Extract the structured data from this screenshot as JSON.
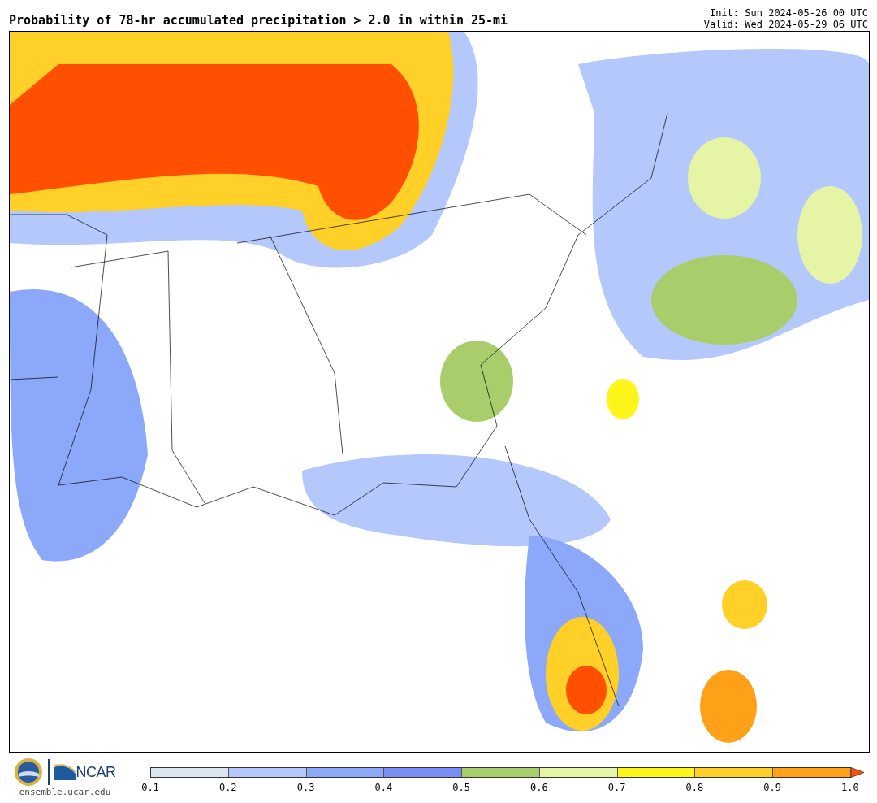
{
  "title": "Probability of 78-hr accumulated precipitation > 2.0 in within 25-mi",
  "init": "Init: Sun 2024-05-26 00 UTC",
  "valid": "Valid: Wed 2024-05-29 06 UTC",
  "footer": {
    "logo_text": "NCAR",
    "url": "ensemble.ucar.edu"
  },
  "colorbar": {
    "bins": [
      {
        "color": "#dbe6f1"
      },
      {
        "color": "#b4c8fc"
      },
      {
        "color": "#8ca8f8"
      },
      {
        "color": "#7a8ef5"
      },
      {
        "color": "#a8cd6a"
      },
      {
        "color": "#e6f4a6"
      },
      {
        "color": "#fff51a"
      },
      {
        "color": "#ffd027"
      },
      {
        "color": "#ffa019"
      }
    ],
    "extend": {
      "color": "#ff4f00"
    },
    "ticks": [
      "0.1",
      "0.2",
      "0.3",
      "0.4",
      "0.5",
      "0.6",
      "0.7",
      "0.8",
      "0.9",
      "1.0"
    ]
  }
}
